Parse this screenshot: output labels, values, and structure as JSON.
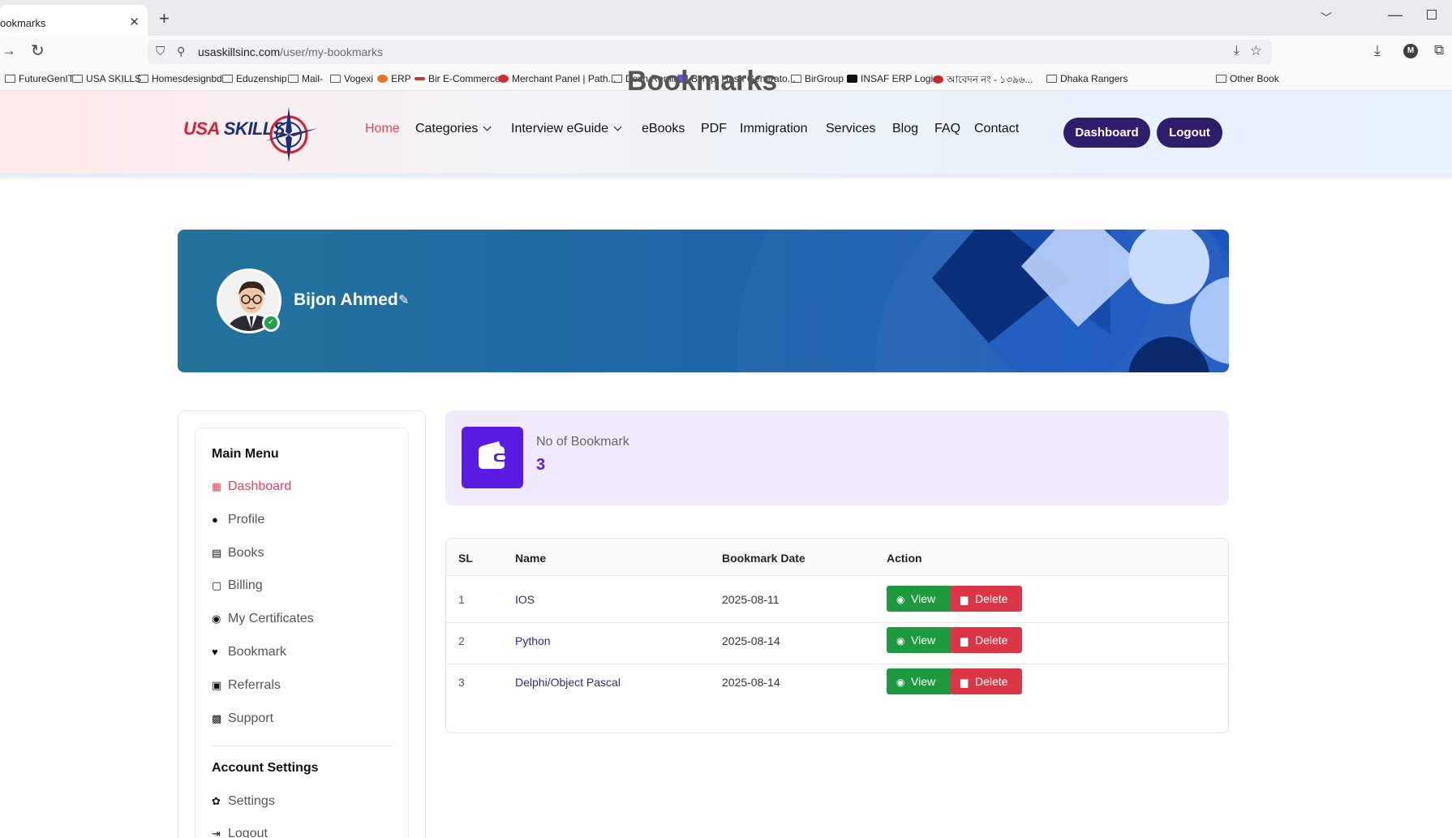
{
  "browser": {
    "tab_title": "ookmarks",
    "url_host": "usaskillsinc.com",
    "url_path": "/user/my-bookmarks",
    "account_initial": "M",
    "bookmarks": [
      {
        "label": "FutureGenIT"
      },
      {
        "label": "USA SKILLS"
      },
      {
        "label": "Homesdesignbd"
      },
      {
        "label": "Eduzenship"
      },
      {
        "label": "Mail-"
      },
      {
        "label": "Vogexi"
      },
      {
        "label": "ERP"
      },
      {
        "label": "Bir E-Commerce"
      },
      {
        "label": "Merchant Panel | Path..."
      },
      {
        "label": "Desh Remit"
      },
      {
        "label": "Bcrypt Hash Generato..."
      },
      {
        "label": "BirGroup"
      },
      {
        "label": "INSAF ERP Login"
      },
      {
        "label": "আবেদন নং - ১৩৯৬..."
      },
      {
        "label": "Dhaka Rangers"
      },
      {
        "label": "Other Book"
      }
    ]
  },
  "site": {
    "ghost_title": "Bookmarks",
    "logo_text_a": "USA",
    "logo_text_b": " SKILLS",
    "nav": [
      {
        "label": "Home"
      },
      {
        "label": "Categories"
      },
      {
        "label": "Interview eGuide"
      },
      {
        "label": "eBooks"
      },
      {
        "label": "PDF"
      },
      {
        "label": "Immigration"
      },
      {
        "label": "Services"
      },
      {
        "label": "Blog"
      },
      {
        "label": "FAQ"
      },
      {
        "label": "Contact"
      }
    ],
    "dashboard_btn": "Dashboard",
    "logout_btn": "Logout"
  },
  "profile": {
    "name": "Bijon Ahmed"
  },
  "sidebar": {
    "main_heading": "Main Menu",
    "items": [
      {
        "label": "Dashboard",
        "icon": "dashboard-icon"
      },
      {
        "label": "Profile",
        "icon": "user-icon"
      },
      {
        "label": "Books",
        "icon": "book-icon"
      },
      {
        "label": "Billing",
        "icon": "billing-icon"
      },
      {
        "label": "My Certificates",
        "icon": "certificate-icon"
      },
      {
        "label": "Bookmark",
        "icon": "heart-icon"
      },
      {
        "label": "Referrals",
        "icon": "referral-icon"
      },
      {
        "label": "Support",
        "icon": "support-icon"
      }
    ],
    "account_heading": "Account Settings",
    "account_items": [
      {
        "label": "Settings",
        "icon": "gear-icon"
      },
      {
        "label": "Logout",
        "icon": "logout-icon"
      }
    ]
  },
  "stat": {
    "label": "No of Bookmark",
    "value": "3"
  },
  "table": {
    "headers": [
      "SL",
      "Name",
      "Bookmark Date",
      "Action"
    ],
    "rows": [
      {
        "sl": "1",
        "name": "IOS",
        "date": "2025-08-11"
      },
      {
        "sl": "2",
        "name": "Python",
        "date": "2025-08-14"
      },
      {
        "sl": "3",
        "name": "Delphi/Object Pascal",
        "date": "2025-08-14"
      }
    ],
    "view_label": "View",
    "delete_label": "Delete"
  },
  "colors": {
    "accent_red": "#e8415a",
    "brand_purple": "#2f1e6b",
    "stat_purple": "#5a1be3",
    "view_green": "#1d9a3d",
    "delete_red": "#dc3545"
  }
}
